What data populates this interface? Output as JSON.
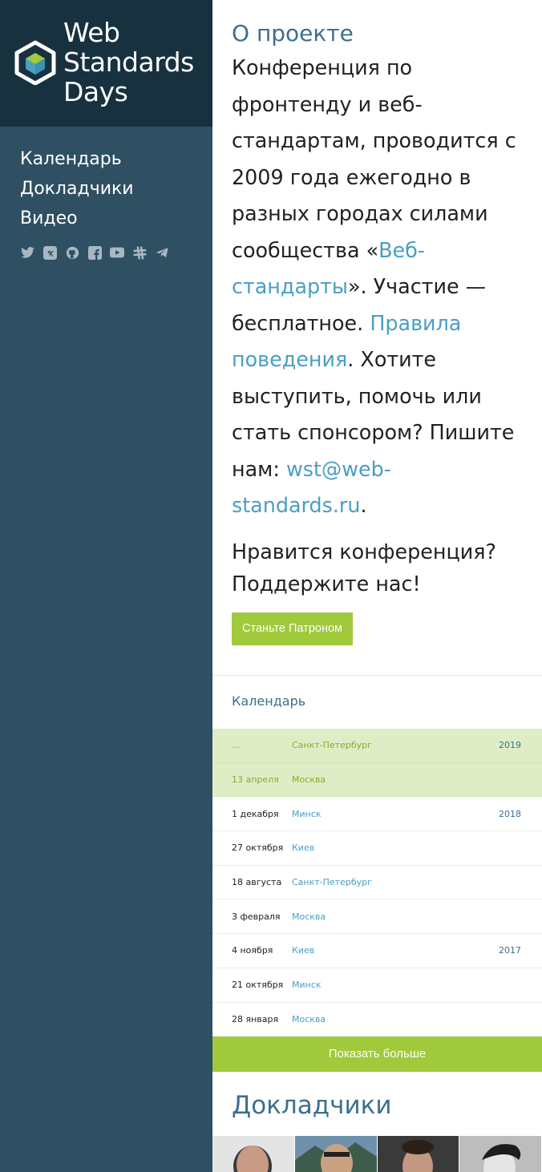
{
  "brand": {
    "name_line1": "Web",
    "name_line2": "Standards",
    "name_line3": "Days"
  },
  "nav": {
    "items": [
      {
        "label": "Календарь"
      },
      {
        "label": "Докладчики"
      },
      {
        "label": "Видео"
      }
    ]
  },
  "socials": [
    "twitter-icon",
    "vk-icon",
    "github-icon",
    "facebook-icon",
    "youtube-icon",
    "slack-icon",
    "telegram-icon"
  ],
  "about": {
    "title": "О проекте",
    "text_1": "Конференция по фронтенду и веб-стандартам, проводится с 2009 года ежегодно в разных городах силами сообщества «",
    "link_community": "Веб-стандарты",
    "text_2": "». Участие — бесплатное. ",
    "link_rules": "Правила поведения",
    "text_3": ". Хотите выступить, помочь или стать спонсором? Пишите нам: ",
    "link_email": "wst@web-standards.ru",
    "text_4": ".",
    "support_line": "Нравится конференция? Поддержите нас!",
    "patron_button": "Станьте Патроном"
  },
  "calendar": {
    "title": "Календарь",
    "rows": [
      {
        "date": "...",
        "city": "Санкт-Петербург",
        "year": "2019",
        "highlight": true
      },
      {
        "date": "13 апреля",
        "city": "Москва",
        "year": "",
        "highlight": true
      },
      {
        "date": "1 декабря",
        "city": "Минск",
        "year": "2018",
        "highlight": false
      },
      {
        "date": "27 октября",
        "city": "Киев",
        "year": "",
        "highlight": false
      },
      {
        "date": "18 августа",
        "city": "Санкт-Петербург",
        "year": "",
        "highlight": false
      },
      {
        "date": "3 февраля",
        "city": "Москва",
        "year": "",
        "highlight": false
      },
      {
        "date": "4 ноября",
        "city": "Киев",
        "year": "2017",
        "highlight": false
      },
      {
        "date": "21 октября",
        "city": "Минск",
        "year": "",
        "highlight": false
      },
      {
        "date": "28 января",
        "city": "Москва",
        "year": "",
        "highlight": false
      }
    ],
    "more_button": "Показать больше"
  },
  "speakers": {
    "title": "Докладчики"
  },
  "colors": {
    "sidebar": "#2f4f63",
    "logo_bg": "#17313f",
    "accent_green": "#a0c93c",
    "link_blue": "#4a9fc4",
    "heading_blue": "#3d6f8c",
    "highlight_row": "#dfedc6"
  }
}
